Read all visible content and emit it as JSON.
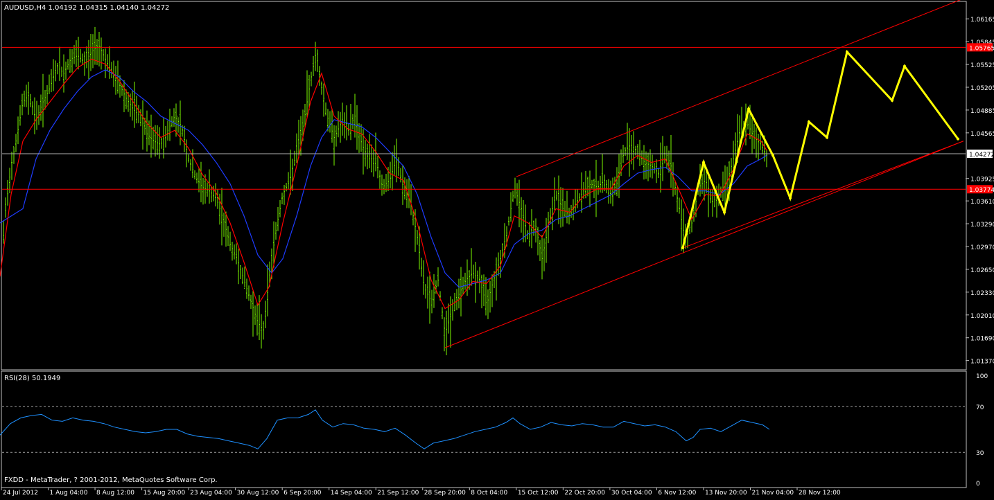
{
  "header": {
    "symbol_line": "AUDUSD,H4  1.04192 1.04315 1.04140 1.04272"
  },
  "footer": {
    "copyright": "FXDD - MetaTrader, ? 2001-2012, MetaQuotes Software Corp."
  },
  "rsi_panel": {
    "label": "RSI(28) 50.1949",
    "levels": [
      "100",
      "70",
      "30",
      "0"
    ]
  },
  "colors": {
    "background": "#000000",
    "frame": "#c0c0c0",
    "bars": "#7cfc00",
    "ma_fast": "#ff0000",
    "ma_slow": "#1e3cff",
    "channel": "#ff0000",
    "projection": "#ffff00",
    "rsi_line": "#1e90ff",
    "current_price_tag": "#ffffff",
    "level_tag": "#ff0000"
  },
  "chart_data": {
    "type": "candlestick",
    "symbol": "AUDUSD",
    "timeframe": "H4",
    "ohlc_last": {
      "open": 1.04192,
      "high": 1.04315,
      "low": 1.0414,
      "close": 1.04272
    },
    "price_ticks": [
      "1.06165",
      "1.05845",
      "1.05525",
      "1.05205",
      "1.04885",
      "1.04565",
      "1.03925",
      "1.03610",
      "1.03290",
      "1.02970",
      "1.02650",
      "1.02330",
      "1.02010",
      "1.01690",
      "1.01370"
    ],
    "price_tag_labels": {
      "resistance": "1.05765",
      "current": "1.04272",
      "support": "1.03774"
    },
    "date_ticks": [
      "24 Jul 2012",
      "1 Aug 04:00",
      "8 Aug 12:00",
      "15 Aug 20:00",
      "23 Aug 04:00",
      "30 Aug 12:00",
      "6 Sep 20:00",
      "14 Sep 04:00",
      "21 Sep 12:00",
      "28 Sep 20:00",
      "8 Oct 04:00",
      "15 Oct 12:00",
      "22 Oct 20:00",
      "30 Oct 04:00",
      "6 Nov 12:00",
      "13 Nov 20:00",
      "21 Nov 04:00",
      "28 Nov 12:00"
    ],
    "y_range": [
      1.0125,
      1.064
    ],
    "horizontal_levels": [
      1.05765,
      1.04272,
      1.03774
    ],
    "price_path": [
      [
        0,
        1.0245
      ],
      [
        7,
        1.034
      ],
      [
        16,
        1.041
      ],
      [
        24,
        1.045
      ],
      [
        33,
        1.05
      ],
      [
        42,
        1.051
      ],
      [
        52,
        1.0475
      ],
      [
        62,
        1.05
      ],
      [
        72,
        1.052
      ],
      [
        82,
        1.055
      ],
      [
        92,
        1.054
      ],
      [
        102,
        1.056
      ],
      [
        112,
        1.0565
      ],
      [
        122,
        1.0555
      ],
      [
        132,
        1.057
      ],
      [
        142,
        1.058
      ],
      [
        152,
        1.056
      ],
      [
        162,
        1.054
      ],
      [
        172,
        1.0525
      ],
      [
        182,
        1.0505
      ],
      [
        192,
        1.049
      ],
      [
        202,
        1.048
      ],
      [
        212,
        1.0455
      ],
      [
        222,
        1.0445
      ],
      [
        232,
        1.044
      ],
      [
        242,
        1.046
      ],
      [
        252,
        1.048
      ],
      [
        262,
        1.0465
      ],
      [
        272,
        1.042
      ],
      [
        282,
        1.0395
      ],
      [
        292,
        1.038
      ],
      [
        302,
        1.0375
      ],
      [
        312,
        1.0365
      ],
      [
        322,
        1.0335
      ],
      [
        332,
        1.03
      ],
      [
        342,
        1.028
      ],
      [
        352,
        1.025
      ],
      [
        362,
        1.022
      ],
      [
        372,
        1.019
      ],
      [
        380,
        1.018
      ],
      [
        388,
        1.025
      ],
      [
        398,
        1.032
      ],
      [
        408,
        1.037
      ],
      [
        418,
        1.039
      ],
      [
        428,
        1.043
      ],
      [
        438,
        1.047
      ],
      [
        448,
        1.053
      ],
      [
        456,
        1.057
      ],
      [
        464,
        1.052
      ],
      [
        472,
        1.048
      ],
      [
        482,
        1.045
      ],
      [
        492,
        1.047
      ],
      [
        502,
        1.046
      ],
      [
        512,
        1.048
      ],
      [
        522,
        1.044
      ],
      [
        532,
        1.042
      ],
      [
        542,
        1.042
      ],
      [
        552,
        1.038
      ],
      [
        562,
        1.039
      ],
      [
        572,
        1.042
      ],
      [
        582,
        1.038
      ],
      [
        592,
        1.036
      ],
      [
        602,
        1.031
      ],
      [
        612,
        1.024
      ],
      [
        622,
        1.022
      ],
      [
        632,
        1.025
      ],
      [
        642,
        1.0175
      ],
      [
        652,
        1.0205
      ],
      [
        662,
        1.023
      ],
      [
        672,
        1.025
      ],
      [
        682,
        1.026
      ],
      [
        692,
        1.025
      ],
      [
        702,
        1.0215
      ],
      [
        712,
        1.025
      ],
      [
        722,
        1.028
      ],
      [
        732,
        1.032
      ],
      [
        742,
        1.038
      ],
      [
        752,
        1.035
      ],
      [
        762,
        1.031
      ],
      [
        772,
        1.033
      ],
      [
        782,
        1.028
      ],
      [
        792,
        1.033
      ],
      [
        802,
        1.037
      ],
      [
        812,
        1.035
      ],
      [
        822,
        1.034
      ],
      [
        832,
        1.036
      ],
      [
        842,
        1.0375
      ],
      [
        852,
        1.0385
      ],
      [
        862,
        1.038
      ],
      [
        872,
        1.039
      ],
      [
        882,
        1.037
      ],
      [
        892,
        1.039
      ],
      [
        900,
        1.043
      ],
      [
        910,
        1.044
      ],
      [
        920,
        1.043
      ],
      [
        930,
        1.0415
      ],
      [
        940,
        1.041
      ],
      [
        950,
        1.04
      ],
      [
        960,
        1.043
      ],
      [
        968,
        1.041
      ],
      [
        978,
        1.036
      ],
      [
        988,
        1.031
      ],
      [
        998,
        1.033
      ],
      [
        1008,
        1.038
      ],
      [
        1018,
        1.039
      ],
      [
        1028,
        1.036
      ],
      [
        1038,
        1.037
      ],
      [
        1048,
        1.0385
      ],
      [
        1058,
        1.042
      ],
      [
        1068,
        1.046
      ],
      [
        1078,
        1.047
      ],
      [
        1088,
        1.045
      ],
      [
        1098,
        1.044
      ],
      [
        1106,
        1.0425
      ]
    ],
    "ma_fast_path": [
      [
        0,
        1.0255
      ],
      [
        16,
        1.037
      ],
      [
        33,
        1.0445
      ],
      [
        52,
        1.0475
      ],
      [
        72,
        1.05
      ],
      [
        92,
        1.0525
      ],
      [
        112,
        1.0548
      ],
      [
        132,
        1.056
      ],
      [
        152,
        1.0553
      ],
      [
        172,
        1.053
      ],
      [
        192,
        1.05
      ],
      [
        212,
        1.047
      ],
      [
        232,
        1.045
      ],
      [
        252,
        1.046
      ],
      [
        272,
        1.0435
      ],
      [
        292,
        1.0398
      ],
      [
        312,
        1.0372
      ],
      [
        332,
        1.033
      ],
      [
        352,
        1.0275
      ],
      [
        372,
        1.0215
      ],
      [
        388,
        1.024
      ],
      [
        408,
        1.033
      ],
      [
        428,
        1.041
      ],
      [
        448,
        1.05
      ],
      [
        464,
        1.054
      ],
      [
        482,
        1.048
      ],
      [
        502,
        1.0462
      ],
      [
        522,
        1.0455
      ],
      [
        542,
        1.043
      ],
      [
        562,
        1.04
      ],
      [
        582,
        1.039
      ],
      [
        602,
        1.033
      ],
      [
        622,
        1.025
      ],
      [
        642,
        1.021
      ],
      [
        662,
        1.0222
      ],
      [
        682,
        1.0248
      ],
      [
        702,
        1.0245
      ],
      [
        722,
        1.027
      ],
      [
        742,
        1.034
      ],
      [
        762,
        1.033
      ],
      [
        782,
        1.031
      ],
      [
        802,
        1.035
      ],
      [
        822,
        1.0345
      ],
      [
        842,
        1.0368
      ],
      [
        862,
        1.0378
      ],
      [
        882,
        1.0378
      ],
      [
        900,
        1.041
      ],
      [
        920,
        1.0425
      ],
      [
        940,
        1.0415
      ],
      [
        960,
        1.042
      ],
      [
        978,
        1.038
      ],
      [
        998,
        1.0335
      ],
      [
        1018,
        1.037
      ],
      [
        1038,
        1.0368
      ],
      [
        1058,
        1.0405
      ],
      [
        1078,
        1.0455
      ],
      [
        1098,
        1.0445
      ],
      [
        1106,
        1.0432
      ]
    ],
    "ma_slow_path": [
      [
        0,
        1.033
      ],
      [
        33,
        1.035
      ],
      [
        52,
        1.042
      ],
      [
        72,
        1.046
      ],
      [
        92,
        1.049
      ],
      [
        112,
        1.0515
      ],
      [
        132,
        1.0535
      ],
      [
        152,
        1.0545
      ],
      [
        172,
        1.0535
      ],
      [
        192,
        1.0515
      ],
      [
        212,
        1.05
      ],
      [
        232,
        1.048
      ],
      [
        252,
        1.047
      ],
      [
        272,
        1.046
      ],
      [
        292,
        1.044
      ],
      [
        312,
        1.0415
      ],
      [
        332,
        1.0385
      ],
      [
        352,
        1.034
      ],
      [
        372,
        1.0285
      ],
      [
        392,
        1.026
      ],
      [
        408,
        1.028
      ],
      [
        428,
        1.034
      ],
      [
        448,
        1.041
      ],
      [
        464,
        1.045
      ],
      [
        482,
        1.0475
      ],
      [
        502,
        1.047
      ],
      [
        522,
        1.0465
      ],
      [
        542,
        1.045
      ],
      [
        562,
        1.043
      ],
      [
        582,
        1.041
      ],
      [
        602,
        1.037
      ],
      [
        622,
        1.031
      ],
      [
        642,
        1.026
      ],
      [
        662,
        1.024
      ],
      [
        682,
        1.0245
      ],
      [
        702,
        1.025
      ],
      [
        722,
        1.026
      ],
      [
        742,
        1.03
      ],
      [
        762,
        1.0315
      ],
      [
        782,
        1.032
      ],
      [
        802,
        1.0335
      ],
      [
        822,
        1.034
      ],
      [
        842,
        1.035
      ],
      [
        862,
        1.036
      ],
      [
        882,
        1.037
      ],
      [
        900,
        1.0385
      ],
      [
        920,
        1.04
      ],
      [
        940,
        1.0405
      ],
      [
        960,
        1.0408
      ],
      [
        978,
        1.0395
      ],
      [
        998,
        1.0375
      ],
      [
        1018,
        1.0375
      ],
      [
        1038,
        1.037
      ],
      [
        1058,
        1.0385
      ],
      [
        1078,
        1.041
      ],
      [
        1098,
        1.042
      ],
      [
        1106,
        1.0425
      ]
    ],
    "channel_lines": [
      {
        "x1": 642,
        "y1": 1.0155,
        "x2": 1390,
        "y2": 1.0445
      },
      {
        "x1": 745,
        "y1": 1.0395,
        "x2": 1390,
        "y2": 1.0645
      },
      {
        "x1": 985,
        "y1": 1.0295,
        "x2": 1390,
        "y2": 1.0445
      }
    ],
    "projection_path": [
      [
        985,
        1.0295
      ],
      [
        1015,
        1.0415
      ],
      [
        1045,
        1.0345
      ],
      [
        1080,
        1.049
      ],
      [
        1115,
        1.0425
      ],
      [
        1140,
        1.0365
      ],
      [
        1167,
        1.0472
      ],
      [
        1193,
        1.045
      ],
      [
        1222,
        1.057
      ],
      [
        1287,
        1.0502
      ],
      [
        1305,
        1.055
      ],
      [
        1382,
        1.0448
      ]
    ],
    "rsi": {
      "period": 28,
      "last": 50.1949,
      "levels": [
        70,
        30
      ],
      "y_range": [
        0,
        100
      ],
      "path": [
        [
          0,
          45
        ],
        [
          15,
          55
        ],
        [
          30,
          60
        ],
        [
          45,
          62
        ],
        [
          60,
          63
        ],
        [
          75,
          58
        ],
        [
          90,
          57
        ],
        [
          105,
          60
        ],
        [
          120,
          58
        ],
        [
          135,
          57
        ],
        [
          150,
          55
        ],
        [
          165,
          52
        ],
        [
          180,
          50
        ],
        [
          195,
          48
        ],
        [
          210,
          47
        ],
        [
          225,
          48
        ],
        [
          240,
          50
        ],
        [
          255,
          50
        ],
        [
          270,
          46
        ],
        [
          285,
          44
        ],
        [
          300,
          43
        ],
        [
          315,
          42
        ],
        [
          330,
          40
        ],
        [
          345,
          38
        ],
        [
          360,
          36
        ],
        [
          372,
          33
        ],
        [
          385,
          42
        ],
        [
          400,
          58
        ],
        [
          415,
          60
        ],
        [
          430,
          60
        ],
        [
          445,
          63
        ],
        [
          455,
          67
        ],
        [
          465,
          58
        ],
        [
          480,
          52
        ],
        [
          495,
          55
        ],
        [
          510,
          54
        ],
        [
          525,
          51
        ],
        [
          540,
          50
        ],
        [
          555,
          48
        ],
        [
          570,
          51
        ],
        [
          585,
          45
        ],
        [
          600,
          38
        ],
        [
          612,
          33
        ],
        [
          625,
          38
        ],
        [
          640,
          40
        ],
        [
          655,
          42
        ],
        [
          670,
          45
        ],
        [
          685,
          48
        ],
        [
          700,
          50
        ],
        [
          715,
          52
        ],
        [
          730,
          56
        ],
        [
          740,
          60
        ],
        [
          750,
          55
        ],
        [
          765,
          50
        ],
        [
          780,
          52
        ],
        [
          795,
          56
        ],
        [
          810,
          54
        ],
        [
          825,
          53
        ],
        [
          840,
          55
        ],
        [
          855,
          54
        ],
        [
          870,
          52
        ],
        [
          885,
          52
        ],
        [
          900,
          57
        ],
        [
          915,
          55
        ],
        [
          930,
          53
        ],
        [
          945,
          54
        ],
        [
          960,
          52
        ],
        [
          975,
          48
        ],
        [
          990,
          40
        ],
        [
          1000,
          43
        ],
        [
          1010,
          50
        ],
        [
          1025,
          51
        ],
        [
          1040,
          48
        ],
        [
          1055,
          53
        ],
        [
          1070,
          58
        ],
        [
          1085,
          56
        ],
        [
          1100,
          54
        ],
        [
          1110,
          50
        ]
      ]
    }
  }
}
